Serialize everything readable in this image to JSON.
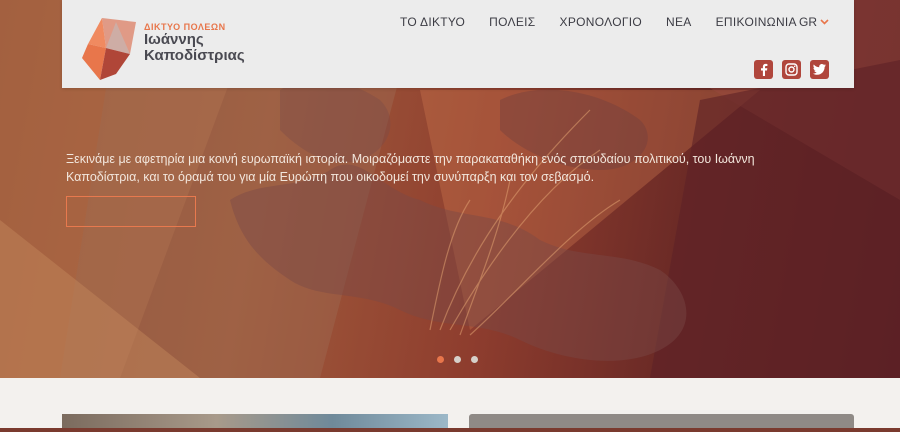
{
  "brand": {
    "network": "ΔΙΚΤΥΟ ΠΟΛΕΩΝ",
    "name_line1": "Ιωάννης",
    "name_line2": "Καποδίστριας"
  },
  "nav": {
    "items": [
      {
        "label": "ΤΟ ΔΙΚΤΥΟ"
      },
      {
        "label": "ΠΟΛΕΙΣ"
      },
      {
        "label": "ΧΡΟΝΟΛΟΓΙΟ"
      },
      {
        "label": "ΝΕΑ"
      },
      {
        "label": "ΕΠΙΚΟΙΝΩΝΙΑ"
      }
    ],
    "language": "GR"
  },
  "socials": {
    "icons": [
      "facebook-icon",
      "instagram-icon",
      "twitter-icon"
    ]
  },
  "hero": {
    "text": "Ξεκινάμε με αφετηρία μια κοινή ευρωπαϊκή ιστορία. Μοιραζόμαστε την παρακαταθήκη ενός σπουδαίου πολιτικού, του Ιωάννη Καποδίστρια, και το όραμά του για μία Ευρώπη που οικοδομεί την συνύπαρξη και τον σεβασμό.",
    "button_label": "",
    "slides": 3,
    "active_slide": 1
  },
  "colors": {
    "accent": "#e8764b",
    "social": "#b0463c",
    "header_bg": "#ececec"
  }
}
